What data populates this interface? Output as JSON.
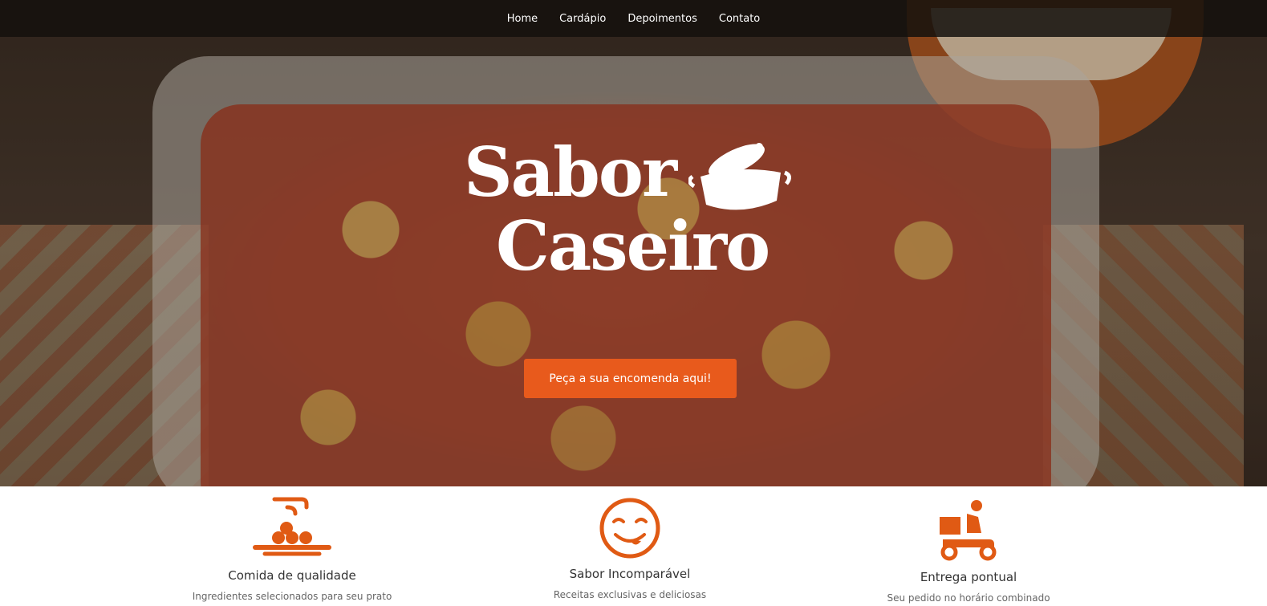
{
  "nav": {
    "items": [
      "Home",
      "Cardápio",
      "Depoimentos",
      "Contato"
    ]
  },
  "hero": {
    "logo_line1": "Sabor",
    "logo_line2": "Caseiro",
    "cta_label": "Peça a sua encomenda aqui!"
  },
  "features": [
    {
      "icon": "food-plate-icon",
      "title": "Comida de qualidade",
      "desc": "Ingredientes selecionados para seu prato"
    },
    {
      "icon": "smile-tongue-icon",
      "title": "Sabor Incomparável",
      "desc": "Receitas exclusivas e deliciosas"
    },
    {
      "icon": "delivery-scooter-icon",
      "title": "Entrega pontual",
      "desc": "Seu pedido no horário combinado"
    }
  ],
  "colors": {
    "accent": "#e85a1c",
    "navbar": "#14100d",
    "icon": "#e05a14"
  }
}
